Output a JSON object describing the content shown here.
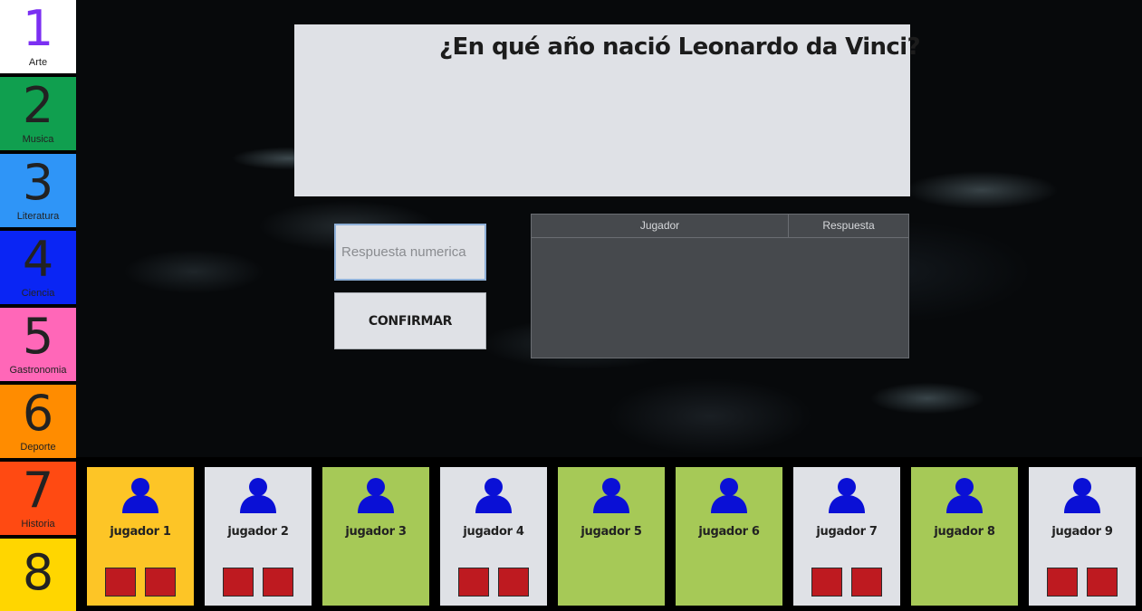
{
  "categories": [
    {
      "number": "1",
      "label": "Arte",
      "bg": "#ffffff",
      "fg": "#7b2ff2"
    },
    {
      "number": "2",
      "label": "Musica",
      "bg": "#109f4f",
      "fg": "#222222"
    },
    {
      "number": "3",
      "label": "Literatura",
      "bg": "#2f95f7",
      "fg": "#222222"
    },
    {
      "number": "4",
      "label": "Ciencia",
      "bg": "#0a25f4",
      "fg": "#222222"
    },
    {
      "number": "5",
      "label": "Gastronomia",
      "bg": "#ff67b8",
      "fg": "#222222"
    },
    {
      "number": "6",
      "label": "Deporte",
      "bg": "#ff8c00",
      "fg": "#222222"
    },
    {
      "number": "7",
      "label": "Historia",
      "bg": "#ff4a12",
      "fg": "#222222"
    },
    {
      "number": "8",
      "label": "",
      "bg": "#ffd600",
      "fg": "#222222"
    }
  ],
  "question": {
    "text": "¿En qué año nació Leonardo da Vinci?"
  },
  "answer": {
    "placeholder": "Respuesta numerica",
    "value": ""
  },
  "confirm": {
    "label": "CONFIRMAR"
  },
  "table": {
    "headers": [
      "Jugador",
      "Respuesta"
    ],
    "rows": []
  },
  "players": [
    {
      "name": "jugador 1",
      "bg": "#fdc526",
      "lives": 2
    },
    {
      "name": "jugador 2",
      "bg": "#dfe1e6",
      "lives": 2
    },
    {
      "name": "jugador 3",
      "bg": "#a6c957",
      "lives": 0
    },
    {
      "name": "jugador 4",
      "bg": "#dfe1e6",
      "lives": 2
    },
    {
      "name": "jugador 5",
      "bg": "#a6c957",
      "lives": 0
    },
    {
      "name": "jugador 6",
      "bg": "#a6c957",
      "lives": 0
    },
    {
      "name": "jugador 7",
      "bg": "#dfe1e6",
      "lives": 2
    },
    {
      "name": "jugador 8",
      "bg": "#a6c957",
      "lives": 0
    },
    {
      "name": "jugador 9",
      "bg": "#dfe1e6",
      "lives": 2
    }
  ],
  "colors": {
    "avatar": "#0a10d6",
    "life": "#be1a20"
  },
  "icons": {
    "player": "user-icon"
  }
}
